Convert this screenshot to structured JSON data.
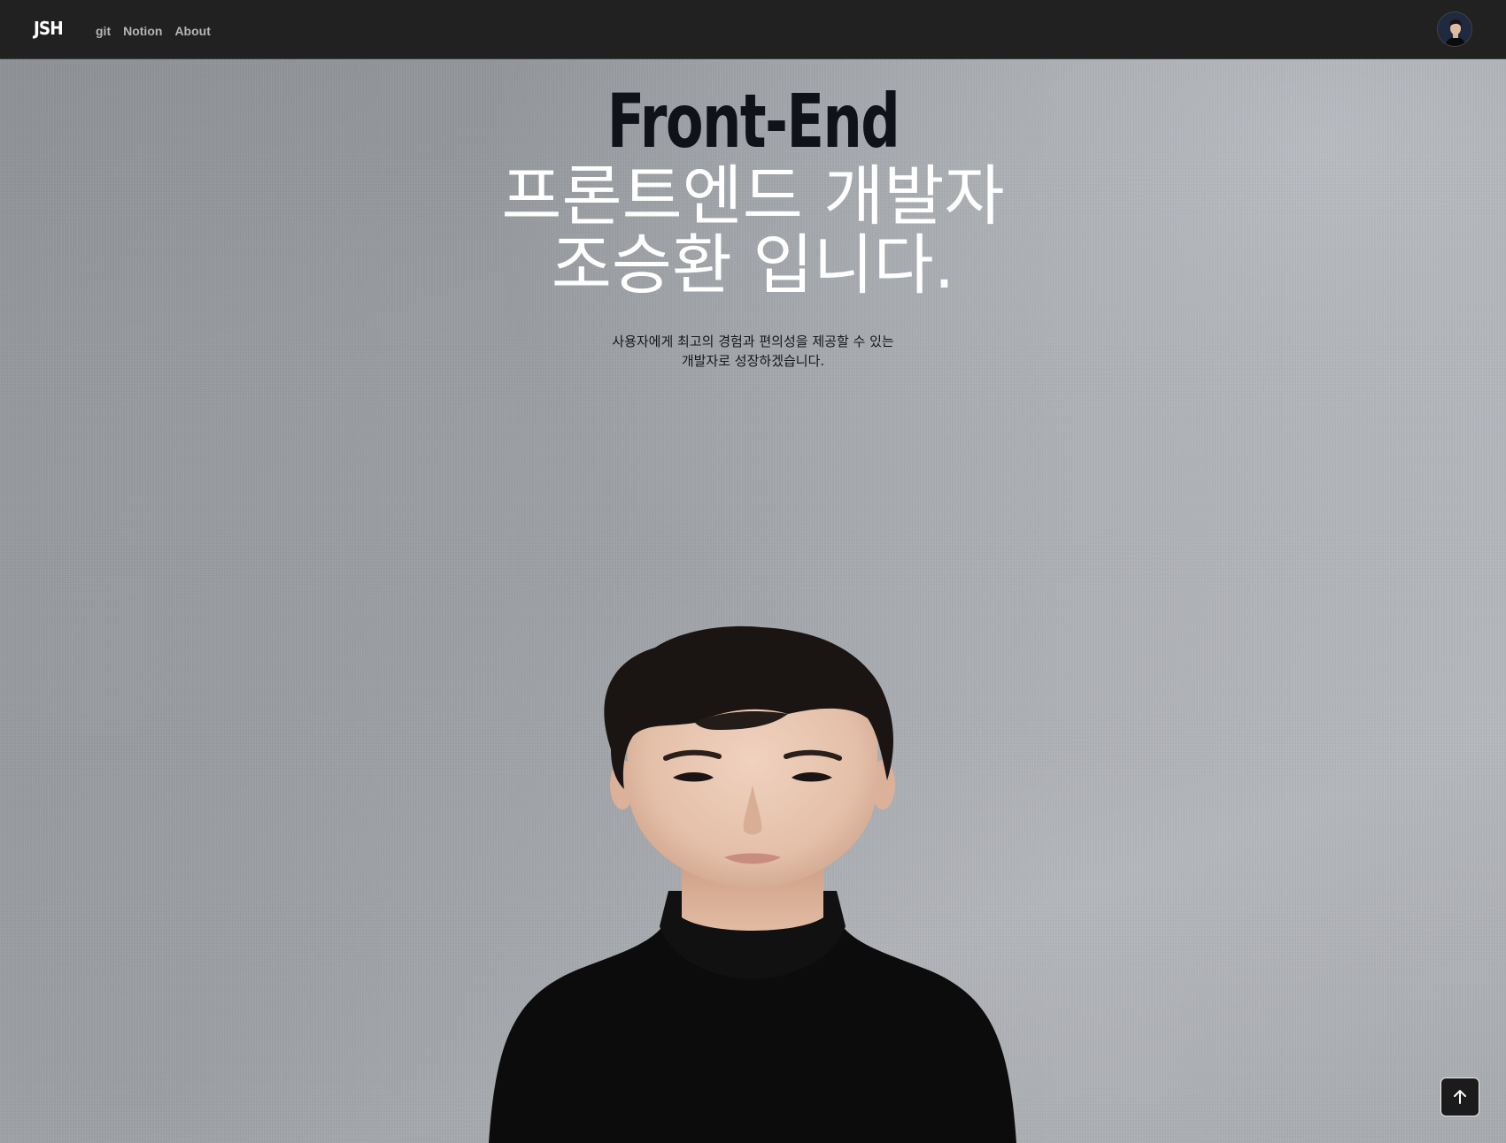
{
  "header": {
    "brand": "JSH",
    "nav": [
      "git",
      "Notion",
      "About"
    ]
  },
  "hero": {
    "title_en": "Front-End",
    "title_ko_line1": "프론트엔드 개발자",
    "title_ko_line2": "조승환 입니다.",
    "subtitle_line1": "사용자에게 최고의 경험과 편의성을 제공할 수 있는",
    "subtitle_line2": "개발자로 성장하겠습니다."
  },
  "icons": {
    "avatar": "profile-avatar-icon",
    "scroll_top": "arrow-up-icon"
  },
  "colors": {
    "header_bg": "#212121",
    "nav_text": "#b5b5b5",
    "title_en": "#101219",
    "title_ko": "#ffffff"
  }
}
